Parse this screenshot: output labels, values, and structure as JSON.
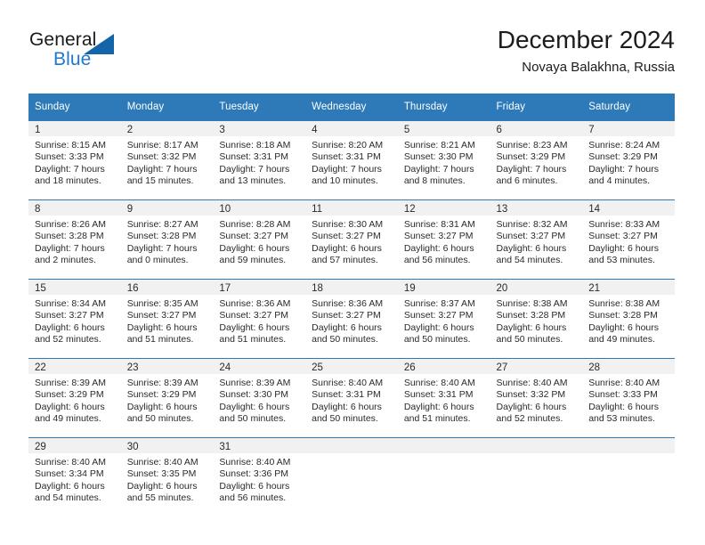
{
  "brand": {
    "name_primary": "General",
    "name_secondary": "Blue",
    "accent_color": "#2277cc",
    "triangle_color": "#1464aa"
  },
  "header": {
    "title": "December 2024",
    "subtitle": "Novaya Balakhna, Russia"
  },
  "calendar": {
    "header_bg": "#2e7ab8",
    "daynum_bg": "#f1f1f1",
    "weekday_headers": [
      "Sunday",
      "Monday",
      "Tuesday",
      "Wednesday",
      "Thursday",
      "Friday",
      "Saturday"
    ],
    "weeks": [
      [
        {
          "day": "1",
          "sunrise": "Sunrise: 8:15 AM",
          "sunset": "Sunset: 3:33 PM",
          "daylight_1": "Daylight: 7 hours",
          "daylight_2": "and 18 minutes."
        },
        {
          "day": "2",
          "sunrise": "Sunrise: 8:17 AM",
          "sunset": "Sunset: 3:32 PM",
          "daylight_1": "Daylight: 7 hours",
          "daylight_2": "and 15 minutes."
        },
        {
          "day": "3",
          "sunrise": "Sunrise: 8:18 AM",
          "sunset": "Sunset: 3:31 PM",
          "daylight_1": "Daylight: 7 hours",
          "daylight_2": "and 13 minutes."
        },
        {
          "day": "4",
          "sunrise": "Sunrise: 8:20 AM",
          "sunset": "Sunset: 3:31 PM",
          "daylight_1": "Daylight: 7 hours",
          "daylight_2": "and 10 minutes."
        },
        {
          "day": "5",
          "sunrise": "Sunrise: 8:21 AM",
          "sunset": "Sunset: 3:30 PM",
          "daylight_1": "Daylight: 7 hours",
          "daylight_2": "and 8 minutes."
        },
        {
          "day": "6",
          "sunrise": "Sunrise: 8:23 AM",
          "sunset": "Sunset: 3:29 PM",
          "daylight_1": "Daylight: 7 hours",
          "daylight_2": "and 6 minutes."
        },
        {
          "day": "7",
          "sunrise": "Sunrise: 8:24 AM",
          "sunset": "Sunset: 3:29 PM",
          "daylight_1": "Daylight: 7 hours",
          "daylight_2": "and 4 minutes."
        }
      ],
      [
        {
          "day": "8",
          "sunrise": "Sunrise: 8:26 AM",
          "sunset": "Sunset: 3:28 PM",
          "daylight_1": "Daylight: 7 hours",
          "daylight_2": "and 2 minutes."
        },
        {
          "day": "9",
          "sunrise": "Sunrise: 8:27 AM",
          "sunset": "Sunset: 3:28 PM",
          "daylight_1": "Daylight: 7 hours",
          "daylight_2": "and 0 minutes."
        },
        {
          "day": "10",
          "sunrise": "Sunrise: 8:28 AM",
          "sunset": "Sunset: 3:27 PM",
          "daylight_1": "Daylight: 6 hours",
          "daylight_2": "and 59 minutes."
        },
        {
          "day": "11",
          "sunrise": "Sunrise: 8:30 AM",
          "sunset": "Sunset: 3:27 PM",
          "daylight_1": "Daylight: 6 hours",
          "daylight_2": "and 57 minutes."
        },
        {
          "day": "12",
          "sunrise": "Sunrise: 8:31 AM",
          "sunset": "Sunset: 3:27 PM",
          "daylight_1": "Daylight: 6 hours",
          "daylight_2": "and 56 minutes."
        },
        {
          "day": "13",
          "sunrise": "Sunrise: 8:32 AM",
          "sunset": "Sunset: 3:27 PM",
          "daylight_1": "Daylight: 6 hours",
          "daylight_2": "and 54 minutes."
        },
        {
          "day": "14",
          "sunrise": "Sunrise: 8:33 AM",
          "sunset": "Sunset: 3:27 PM",
          "daylight_1": "Daylight: 6 hours",
          "daylight_2": "and 53 minutes."
        }
      ],
      [
        {
          "day": "15",
          "sunrise": "Sunrise: 8:34 AM",
          "sunset": "Sunset: 3:27 PM",
          "daylight_1": "Daylight: 6 hours",
          "daylight_2": "and 52 minutes."
        },
        {
          "day": "16",
          "sunrise": "Sunrise: 8:35 AM",
          "sunset": "Sunset: 3:27 PM",
          "daylight_1": "Daylight: 6 hours",
          "daylight_2": "and 51 minutes."
        },
        {
          "day": "17",
          "sunrise": "Sunrise: 8:36 AM",
          "sunset": "Sunset: 3:27 PM",
          "daylight_1": "Daylight: 6 hours",
          "daylight_2": "and 51 minutes."
        },
        {
          "day": "18",
          "sunrise": "Sunrise: 8:36 AM",
          "sunset": "Sunset: 3:27 PM",
          "daylight_1": "Daylight: 6 hours",
          "daylight_2": "and 50 minutes."
        },
        {
          "day": "19",
          "sunrise": "Sunrise: 8:37 AM",
          "sunset": "Sunset: 3:27 PM",
          "daylight_1": "Daylight: 6 hours",
          "daylight_2": "and 50 minutes."
        },
        {
          "day": "20",
          "sunrise": "Sunrise: 8:38 AM",
          "sunset": "Sunset: 3:28 PM",
          "daylight_1": "Daylight: 6 hours",
          "daylight_2": "and 50 minutes."
        },
        {
          "day": "21",
          "sunrise": "Sunrise: 8:38 AM",
          "sunset": "Sunset: 3:28 PM",
          "daylight_1": "Daylight: 6 hours",
          "daylight_2": "and 49 minutes."
        }
      ],
      [
        {
          "day": "22",
          "sunrise": "Sunrise: 8:39 AM",
          "sunset": "Sunset: 3:29 PM",
          "daylight_1": "Daylight: 6 hours",
          "daylight_2": "and 49 minutes."
        },
        {
          "day": "23",
          "sunrise": "Sunrise: 8:39 AM",
          "sunset": "Sunset: 3:29 PM",
          "daylight_1": "Daylight: 6 hours",
          "daylight_2": "and 50 minutes."
        },
        {
          "day": "24",
          "sunrise": "Sunrise: 8:39 AM",
          "sunset": "Sunset: 3:30 PM",
          "daylight_1": "Daylight: 6 hours",
          "daylight_2": "and 50 minutes."
        },
        {
          "day": "25",
          "sunrise": "Sunrise: 8:40 AM",
          "sunset": "Sunset: 3:31 PM",
          "daylight_1": "Daylight: 6 hours",
          "daylight_2": "and 50 minutes."
        },
        {
          "day": "26",
          "sunrise": "Sunrise: 8:40 AM",
          "sunset": "Sunset: 3:31 PM",
          "daylight_1": "Daylight: 6 hours",
          "daylight_2": "and 51 minutes."
        },
        {
          "day": "27",
          "sunrise": "Sunrise: 8:40 AM",
          "sunset": "Sunset: 3:32 PM",
          "daylight_1": "Daylight: 6 hours",
          "daylight_2": "and 52 minutes."
        },
        {
          "day": "28",
          "sunrise": "Sunrise: 8:40 AM",
          "sunset": "Sunset: 3:33 PM",
          "daylight_1": "Daylight: 6 hours",
          "daylight_2": "and 53 minutes."
        }
      ],
      [
        {
          "day": "29",
          "sunrise": "Sunrise: 8:40 AM",
          "sunset": "Sunset: 3:34 PM",
          "daylight_1": "Daylight: 6 hours",
          "daylight_2": "and 54 minutes."
        },
        {
          "day": "30",
          "sunrise": "Sunrise: 8:40 AM",
          "sunset": "Sunset: 3:35 PM",
          "daylight_1": "Daylight: 6 hours",
          "daylight_2": "and 55 minutes."
        },
        {
          "day": "31",
          "sunrise": "Sunrise: 8:40 AM",
          "sunset": "Sunset: 3:36 PM",
          "daylight_1": "Daylight: 6 hours",
          "daylight_2": "and 56 minutes."
        },
        {
          "day": "",
          "sunrise": "",
          "sunset": "",
          "daylight_1": "",
          "daylight_2": ""
        },
        {
          "day": "",
          "sunrise": "",
          "sunset": "",
          "daylight_1": "",
          "daylight_2": ""
        },
        {
          "day": "",
          "sunrise": "",
          "sunset": "",
          "daylight_1": "",
          "daylight_2": ""
        },
        {
          "day": "",
          "sunrise": "",
          "sunset": "",
          "daylight_1": "",
          "daylight_2": ""
        }
      ]
    ]
  }
}
